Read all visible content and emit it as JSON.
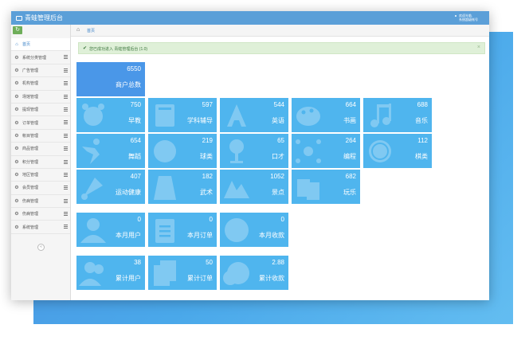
{
  "app": {
    "title": "青蛙管理后台",
    "user_line1": "欢迎光临,",
    "user_line2": "系统超级帐号"
  },
  "sidebar": {
    "toggle_icon": "refresh-icon",
    "collapse_icon": "double-chevron-left-icon",
    "items": [
      {
        "label": "首页",
        "icon": "home-icon",
        "active": true
      },
      {
        "label": "系统分类管理",
        "icon": "gears-icon"
      },
      {
        "label": "广告管理",
        "icon": "gears-icon"
      },
      {
        "label": "机构管理",
        "icon": "gears-icon"
      },
      {
        "label": "场馆管理",
        "icon": "gears-icon"
      },
      {
        "label": "提现管理",
        "icon": "gears-icon"
      },
      {
        "label": "订单管理",
        "icon": "gears-icon"
      },
      {
        "label": "帐目管理",
        "icon": "gears-icon"
      },
      {
        "label": "商品管理",
        "icon": "gears-icon"
      },
      {
        "label": "积分管理",
        "icon": "gears-icon"
      },
      {
        "label": "地区管理",
        "icon": "gears-icon"
      },
      {
        "label": "会员管理",
        "icon": "gears-icon"
      },
      {
        "label": "伤病管理",
        "icon": "gears-icon"
      },
      {
        "label": "伤病管理",
        "icon": "gears-icon"
      },
      {
        "label": "系统管理",
        "icon": "gears-icon"
      }
    ]
  },
  "breadcrumb": {
    "home_icon": "home-icon",
    "label": "首页"
  },
  "alert": {
    "message": "您已成功进入 青蛙管理后台 (1.0)",
    "close": "×"
  },
  "tiles": [
    {
      "value": "6550",
      "label": "商户总数",
      "icon": "none"
    },
    {
      "value": "750",
      "label": "早教",
      "icon": "child-face-icon"
    },
    {
      "value": "597",
      "label": "学科辅导",
      "icon": "book-icon"
    },
    {
      "value": "544",
      "label": "英语",
      "icon": "letter-a-icon"
    },
    {
      "value": "664",
      "label": "书画",
      "icon": "palette-icon"
    },
    {
      "value": "688",
      "label": "音乐",
      "icon": "music-note-icon"
    },
    {
      "value": "654",
      "label": "舞蹈",
      "icon": "dancer-icon"
    },
    {
      "value": "219",
      "label": "球类",
      "icon": "basketball-icon"
    },
    {
      "value": "65",
      "label": "口才",
      "icon": "microphone-icon"
    },
    {
      "value": "264",
      "label": "编程",
      "icon": "network-icon"
    },
    {
      "value": "112",
      "label": "棋类",
      "icon": "chess-piece-icon"
    },
    {
      "value": "407",
      "label": "运动健康",
      "icon": "badminton-icon"
    },
    {
      "value": "182",
      "label": "武术",
      "icon": "martial-robe-icon"
    },
    {
      "value": "1052",
      "label": "景点",
      "icon": "mountain-icon"
    },
    {
      "value": "682",
      "label": "玩乐",
      "icon": "cards-icon"
    },
    {
      "value": "0",
      "label": "本月用户",
      "icon": "user-icon"
    },
    {
      "value": "0",
      "label": "本月订单",
      "icon": "clipboard-icon"
    },
    {
      "value": "0",
      "label": "本月收款",
      "icon": "yen-coin-icon"
    },
    {
      "value": "38",
      "label": "累计用户",
      "icon": "users-icon"
    },
    {
      "value": "50",
      "label": "累计订单",
      "icon": "clipboards-icon"
    },
    {
      "value": "2.88",
      "label": "累计收款",
      "icon": "yen-coins-icon"
    }
  ]
}
